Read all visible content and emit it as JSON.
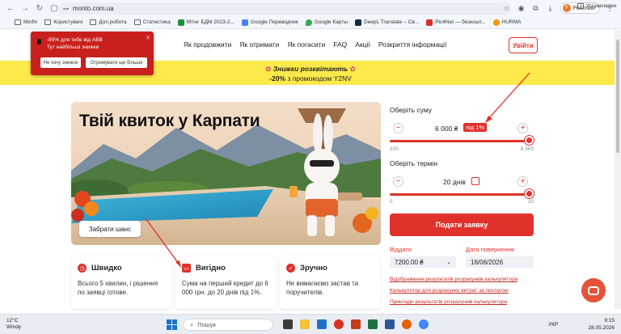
{
  "browser": {
    "url": "monto.com.ua",
    "profile_label": "Робочий",
    "profile_initial": "Р"
  },
  "bookmarks": {
    "items": [
      {
        "label": "Minfin",
        "icon": "folder-icon"
      },
      {
        "label": "Користувачі",
        "icon": "folder-icon"
      },
      {
        "label": "Доп.робота",
        "icon": "folder-icon"
      },
      {
        "label": "Статистика",
        "icon": "folder-icon"
      },
      {
        "label": "Мтінг БДМ 2023-2...",
        "icon": "sheet-icon"
      },
      {
        "label": "Google Переводчик",
        "icon": "translate-icon"
      },
      {
        "label": "Google Карты",
        "icon": "maps-icon"
      },
      {
        "label": "DeepL Translate – Св...",
        "icon": "deepl-icon"
      },
      {
        "label": "Pic4Net — безкошт...",
        "icon": "pic-icon"
      },
      {
        "label": "HURMA",
        "icon": "hurma-icon"
      }
    ],
    "all_bookmarks": "Усі закладки"
  },
  "nav": {
    "links": [
      "Як продовжити",
      "Як отримати",
      "Як погасити",
      "FAQ",
      "Акції",
      "Розкриття інформації"
    ],
    "login": "Увійти"
  },
  "promo": {
    "line1": "Знижки розквітають",
    "line2_bold": "-20%",
    "line2_rest": "з промокодом Y2NV"
  },
  "popup": {
    "line1": "-85% для тебе від АВВ",
    "line2": "Тут найбільші знижки",
    "decline": "Не хочу знижок",
    "accept": "Отримувати ще більше"
  },
  "hero": {
    "title": "Твій квиток у Карпати",
    "button": "Забрати шанс"
  },
  "features": [
    {
      "title": "Швидко",
      "text": "Всього 5 хвилин, і рішення по заявці готове."
    },
    {
      "title": "Вигідно",
      "text": "Сума на перший кредит до 6 000 грн. до 20 днів під 1%."
    },
    {
      "title": "Зручно",
      "text": "Не вимагаємо застав та поручителів."
    }
  ],
  "calculator": {
    "amount_label": "Оберіть суму",
    "amount_value": "6 000 ₴",
    "rate_badge": "під 1%",
    "amount_min": "100",
    "amount_max": "6 000",
    "amount_fraction": 1.0,
    "term_label": "Оберіть термін",
    "term_value": "20 днів",
    "term_min": "5",
    "term_max": "20",
    "term_fraction": 1.0,
    "apply_button": "Подати заявку",
    "return_label": "Віддати",
    "return_value": "7200.00 ₴",
    "date_label": "Дата повернення",
    "date_value": "16/06/2026",
    "links": [
      "Відображення результатів розрахунків калькулятора",
      "Калькулятор для розрахунку витрат за послугою",
      "Приклади результатів розрахунків калькулятора"
    ]
  },
  "taskbar": {
    "temp": "12°C",
    "weather": "Windy",
    "search_placeholder": "Пошук",
    "lang": "УКР",
    "time": "9:15",
    "date": "28.05.2026"
  }
}
